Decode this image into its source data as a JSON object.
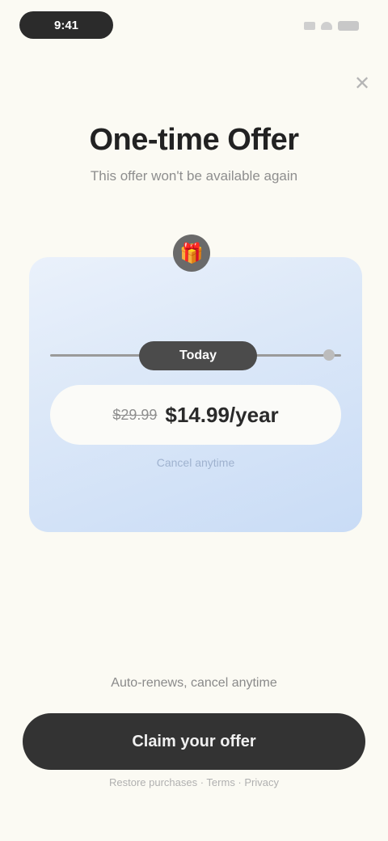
{
  "status_bar": {
    "time": "9:41",
    "icons": [
      "signal-icon",
      "wifi-icon",
      "battery-icon"
    ]
  },
  "header": {
    "close_icon": "close-icon",
    "title": "One-time Offer",
    "subtitle": "This offer won't be available again"
  },
  "offer_card": {
    "gift_icon": "gift-icon",
    "timeline_label": "Today",
    "price_old": "$29.99",
    "price_new": "$14.99/year",
    "note": "Cancel anytime"
  },
  "footer": {
    "terms": "Auto-renews, cancel anytime",
    "cta_label": "Claim your offer",
    "footnote": "Restore purchases · Terms · Privacy"
  },
  "colors": {
    "background": "#fbfaf3",
    "card_gradient_start": "#eaf1fb",
    "card_gradient_end": "#c9dcf6",
    "cta": "#333333"
  }
}
